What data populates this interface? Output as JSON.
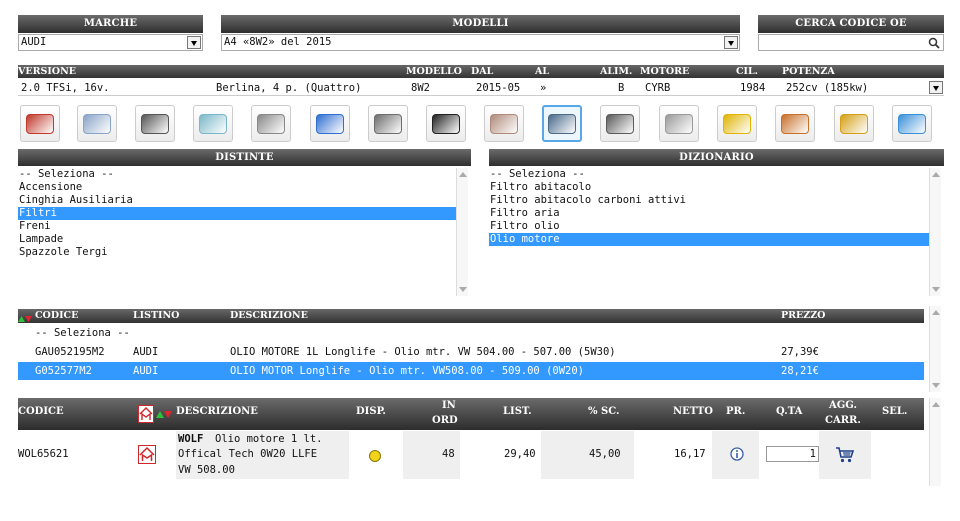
{
  "marche": {
    "header": "MARCHE",
    "value": "AUDI"
  },
  "modelli": {
    "header": "MODELLI",
    "value": "A4 «8W2» del 2015"
  },
  "cerca": {
    "header": "CERCA CODICE OE",
    "value": ""
  },
  "versione": {
    "headers": {
      "versione": "VERSIONE",
      "modello": "MODELLO",
      "dal": "DAL",
      "al": "AL",
      "alim": "ALIM.",
      "motore": "MOTORE",
      "cil": "CIL.",
      "potenza": "POTENZA"
    },
    "row": {
      "versione": "2.0 TFSi, 16v.",
      "carrozzeria": "Berlina, 4 p. (Quattro)",
      "modello": "8W2",
      "dal": "2015-05",
      "al": "»",
      "alim": "B",
      "motore": "CYRB",
      "cil": "1984",
      "potenza": "252cv (185kw)"
    }
  },
  "categories": [
    {
      "name": "dashboard-icon",
      "color": "#c0392b"
    },
    {
      "name": "engine-parts-icon",
      "color": "#8aa4c8"
    },
    {
      "name": "transmission-icon",
      "color": "#555555"
    },
    {
      "name": "body-icon",
      "color": "#7ab8c9"
    },
    {
      "name": "headlight-icon",
      "color": "#888888"
    },
    {
      "name": "filter-box-icon",
      "color": "#2f6fd0"
    },
    {
      "name": "suspension-icon",
      "color": "#6d6d6d"
    },
    {
      "name": "belt-icon",
      "color": "#222222"
    },
    {
      "name": "brake-pads-icon",
      "color": "#b08a7a"
    },
    {
      "name": "wrench-icon",
      "color": "#4a6a8a"
    },
    {
      "name": "engine-block-icon",
      "color": "#5a5a5a"
    },
    {
      "name": "exhaust-icon",
      "color": "#9a9a9a"
    },
    {
      "name": "wipers-icon",
      "color": "#e0b400"
    },
    {
      "name": "steering-icon",
      "color": "#c8702a"
    },
    {
      "name": "ignition-icon",
      "color": "#d4a017"
    },
    {
      "name": "air-conditioning-icon",
      "color": "#3a8fd8"
    }
  ],
  "distinte": {
    "header": "DISTINTE",
    "items": [
      "-- Seleziona --",
      "Accensione",
      "Cinghia Ausiliaria",
      "Filtri",
      "Freni",
      "Lampade",
      "Spazzole Tergi"
    ],
    "selected_label": "Filtri"
  },
  "dizionario": {
    "header": "DIZIONARIO",
    "items": [
      "-- Seleziona --",
      "Filtro abitacolo",
      "Filtro abitacolo carboni attivi",
      "Filtro aria",
      "Filtro olio",
      "Olio motore"
    ],
    "selected_label": "Olio motore"
  },
  "codici": {
    "headers": {
      "codice": "CODICE",
      "listino": "LISTINO",
      "descrizione": "DESCRIZIONE",
      "prezzo": "PREZZO"
    },
    "placeholder_row": "-- Seleziona --",
    "rows": [
      {
        "codice": "GAU052195M2",
        "listino": "AUDI",
        "descrizione": "OLIO MOTORE 1L Longlife - Olio mtr. VW 504.00 - 507.00 (5W30)",
        "prezzo": "27,39€"
      },
      {
        "codice": "G052577M2",
        "listino": "AUDI",
        "descrizione": "OLIO MOTOR Longlife - Olio mtr. VW508.00 - 509.00 (0W20)",
        "prezzo": "28,21€"
      }
    ],
    "selected_codice": "G052577M2"
  },
  "risultati": {
    "headers": {
      "codice": "CODICE",
      "descrizione": "DESCRIZIONE",
      "disp": "DISP.",
      "in_ord_1": "IN",
      "in_ord_2": "ORD",
      "list": "LIST.",
      "sc": "% SC.",
      "netto": "NETTO",
      "pr": "PR.",
      "qta": "Q.TA",
      "agg_1": "AGG.",
      "agg_2": "CARR.",
      "sel": "SEL."
    },
    "row": {
      "codice": "WOL65621",
      "brand": "WOLF",
      "desc_line1": "Olio motore 1 lt.",
      "desc_line2": "Offical Tech 0W20 LLFE",
      "desc_line3": "VW 508.00",
      "in_ord": "48",
      "list": "29,40",
      "sc": "45,00",
      "netto": "16,17",
      "qta": "1"
    },
    "colors": {
      "availability": "#f2d21b",
      "brand_logo": "#d0262b"
    }
  }
}
